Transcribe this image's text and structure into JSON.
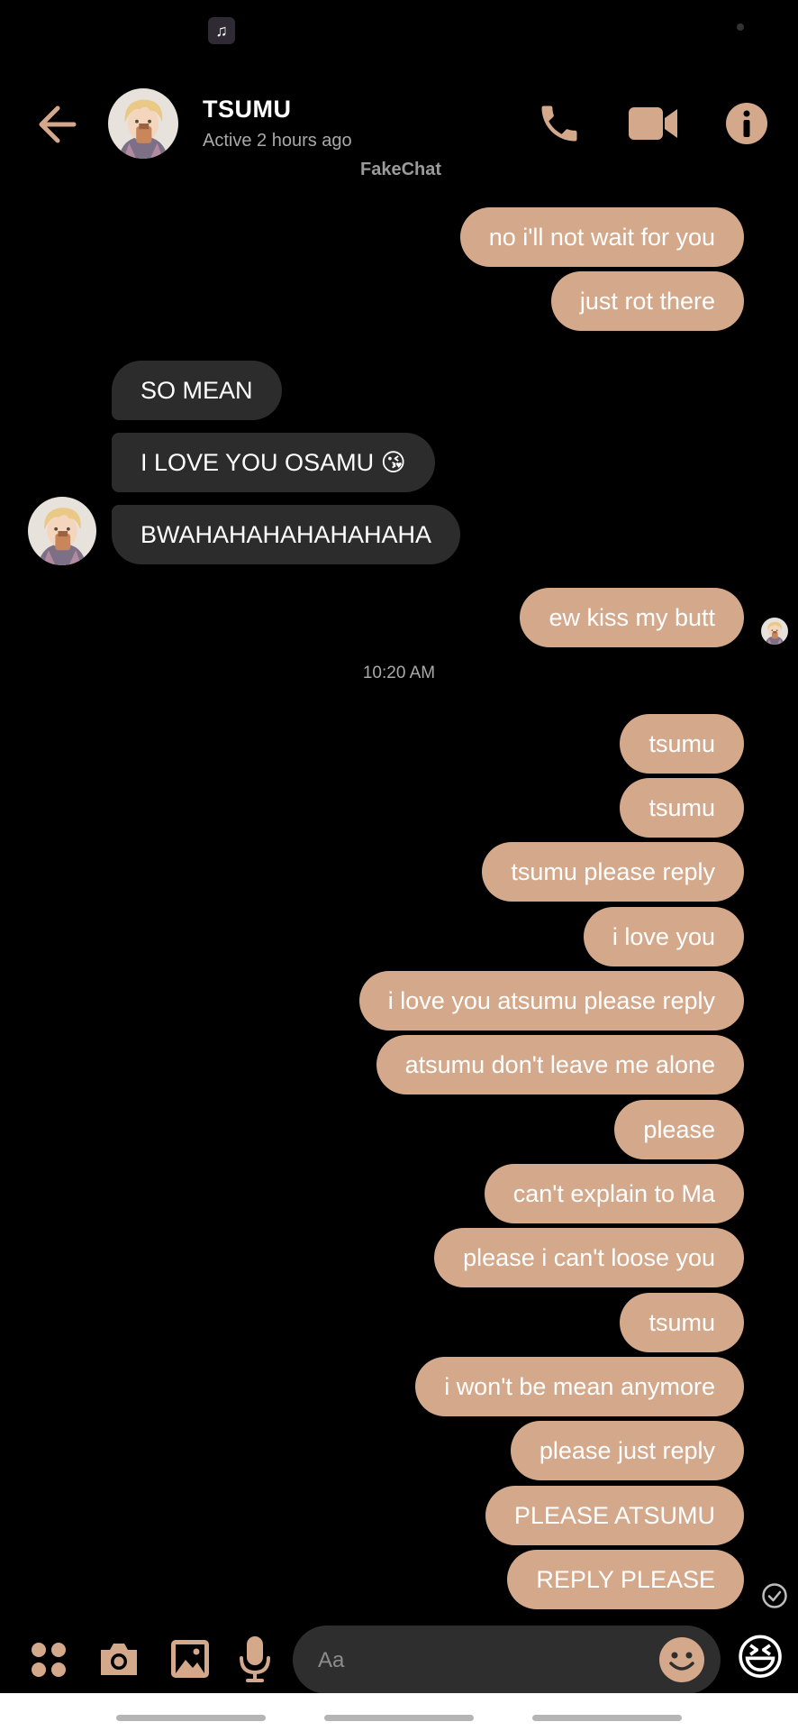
{
  "header": {
    "name": "TSUMU",
    "status": "Active 2 hours ago",
    "watermark": "FakeChat"
  },
  "icons": {
    "back": "back-arrow-icon",
    "call": "phone-icon",
    "video": "video-camera-icon",
    "info": "info-icon",
    "apps": "apps-grid-icon",
    "camera": "camera-icon",
    "gallery": "image-icon",
    "mic": "microphone-icon",
    "emoji": "smiley-icon",
    "quick_reaction": "laughing-emoji-icon",
    "music": "music-note-icon",
    "seen": "sent-check-icon"
  },
  "colors": {
    "accent": "#d4a88b",
    "incoming_bubble": "#2c2c2c",
    "background": "#000000"
  },
  "messages": {
    "out_1": "no i'll not wait for you",
    "out_2": "just rot there",
    "in_1": "SO MEAN",
    "in_2": "I LOVE YOU OSAMU 😘",
    "in_3": "BWAHAHAHAHAHAHAHA",
    "out_3": "ew kiss my butt",
    "timestamp": "10:20 AM",
    "out_4": "tsumu",
    "out_5": "tsumu",
    "out_6": "tsumu please reply",
    "out_7": "i love you",
    "out_8": "i love you atsumu please reply",
    "out_9": "atsumu don't leave me alone",
    "out_10": "please",
    "out_11": "can't explain to Ma",
    "out_12": "please i can't loose you",
    "out_13": "tsumu",
    "out_14": "i won't be mean anymore",
    "out_15": "please just reply",
    "out_16": "PLEASE ATSUMU",
    "out_17": "REPLY PLEASE"
  },
  "composer": {
    "placeholder": "Aa",
    "quick_reaction_emoji": "😆"
  }
}
